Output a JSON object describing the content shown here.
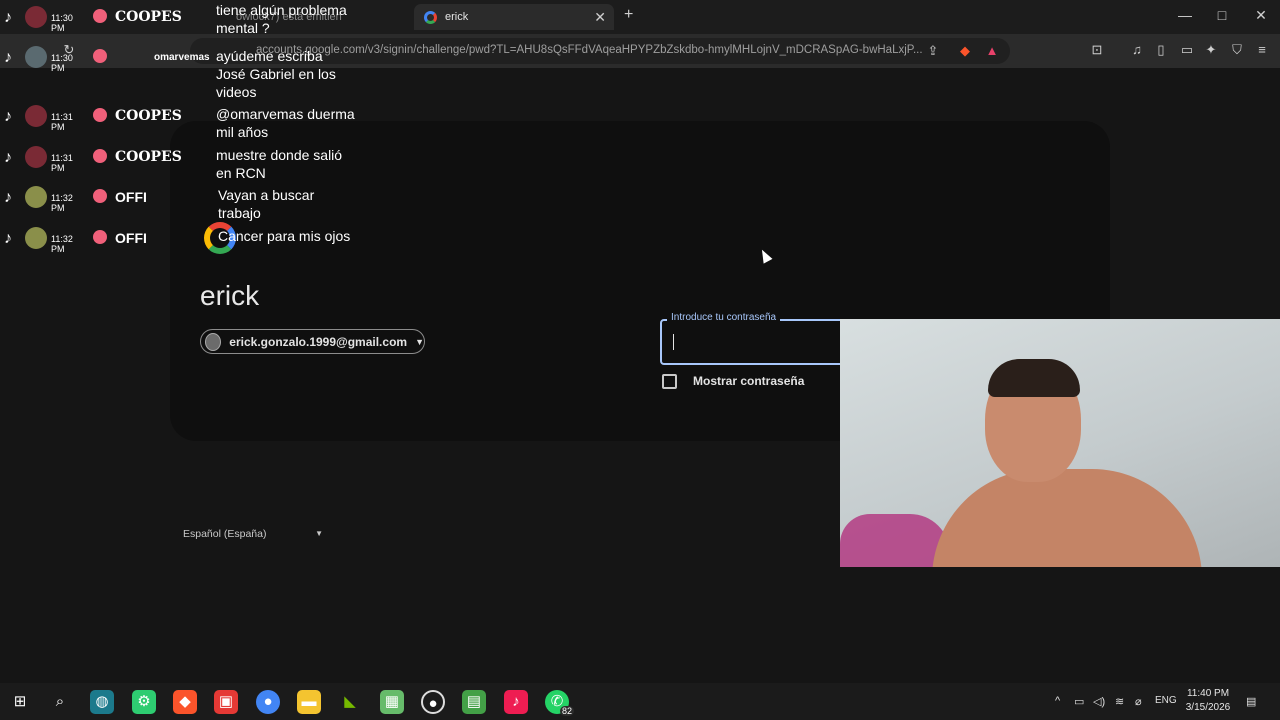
{
  "browser": {
    "tabs": [
      {
        "label": "owlock7) está emitien"
      },
      {
        "label": "erick"
      }
    ],
    "url": "accounts.google.com/v3/signin/challenge/pwd?TL=AHU8sQsFFdVAqeaHPYPZbZskdbo-hmylMHLojnV_mDCRASpAG-bwHaLxjP..."
  },
  "signin": {
    "name": "erick",
    "email": "erick.gonzalo.1999@gmail.com",
    "password_label": "Introduce tu contraseña",
    "show_password_label": "Mostrar contraseña",
    "language": "Español (España)"
  },
  "chat": [
    {
      "time": "11:30 PM",
      "user": "COOPES",
      "message": "tiene algún problema mental ?"
    },
    {
      "time": "11:30 PM",
      "user": "omarvemas",
      "message": "ayúdeme escriba José Gabriel en los videos"
    },
    {
      "time": "11:31 PM",
      "user": "COOPES",
      "message": "@omarvemas duerma mil años"
    },
    {
      "time": "11:31 PM",
      "user": "COOPES",
      "message": "muestre donde salió en RCN"
    },
    {
      "time": "11:32 PM",
      "user": "OFFI",
      "message": "Vayan a buscar trabajo"
    },
    {
      "time": "11:32 PM",
      "user": "OFFI",
      "message": "Cancer para mis ojos"
    }
  ],
  "taskbar": {
    "language": "ENG",
    "time": "11:40 PM",
    "date": "3/15/2026",
    "whatsapp_badge": "82"
  }
}
